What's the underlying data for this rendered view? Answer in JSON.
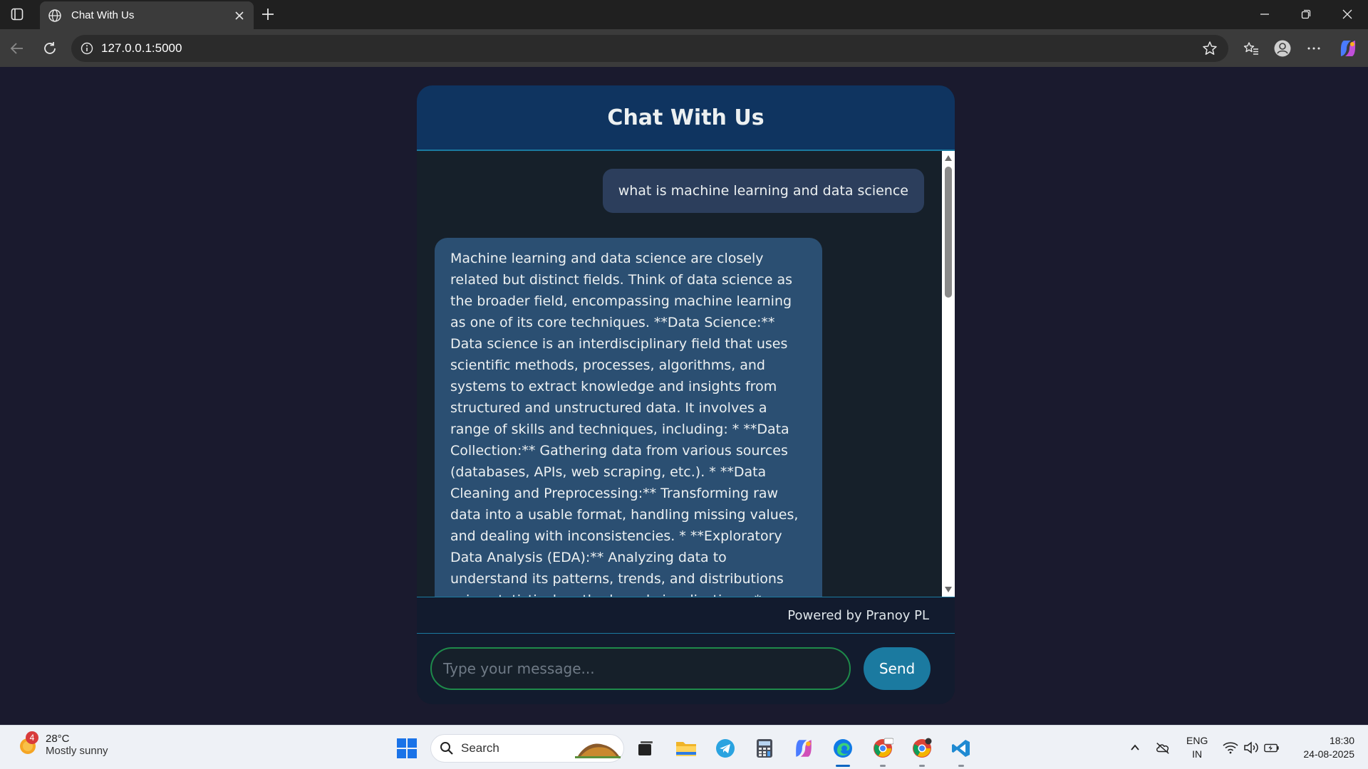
{
  "browser": {
    "tab_title": "Chat With Us",
    "url": "127.0.0.1:5000"
  },
  "chat": {
    "header_title": "Chat With Us",
    "user_message": "what is machine learning and data science",
    "bot_message": "Machine learning and data science are closely related but distinct fields. Think of data science as the broader field, encompassing machine learning as one of its core techniques. **Data Science:** Data science is an interdisciplinary field that uses scientific methods, processes, algorithms, and systems to extract knowledge and insights from structured and unstructured data. It involves a range of skills and techniques, including: * **Data Collection:** Gathering data from various sources (databases, APIs, web scraping, etc.). * **Data Cleaning and Preprocessing:** Transforming raw data into a usable format, handling missing values, and dealing with inconsistencies. * **Exploratory Data Analysis (EDA):** Analyzing data to understand its patterns, trends, and distributions using statistical methods and visualizations. * **Feature Engineering:** Selecting, transforming, and",
    "footer_text": "Powered by Pranoy PL",
    "input_placeholder": "Type your message...",
    "send_label": "Send"
  },
  "taskbar": {
    "weather_badge": "4",
    "weather_temp": "28°C",
    "weather_condition": "Mostly sunny",
    "search_label": "Search",
    "lang_line1": "ENG",
    "lang_line2": "IN",
    "time": "18:30",
    "date": "24-08-2025"
  },
  "colors": {
    "page_bg": "#1a1a2e",
    "header_bg": "#0f3460",
    "accent": "#1b7aa0",
    "bot_bubble": "#2b4f72",
    "user_bubble": "#2c3e5c",
    "input_border": "#1e8a4a"
  },
  "icons": {
    "tab_actions": "tab-actions-icon",
    "favicon": "globe-icon",
    "tab_close": "close-icon",
    "new_tab": "plus-icon",
    "back": "back-arrow-icon",
    "refresh": "refresh-icon",
    "site_info": "info-icon",
    "favorite": "star-icon",
    "favorites": "favorites-icon",
    "profile": "profile-icon",
    "more": "more-icon",
    "copilot": "copilot-icon"
  }
}
